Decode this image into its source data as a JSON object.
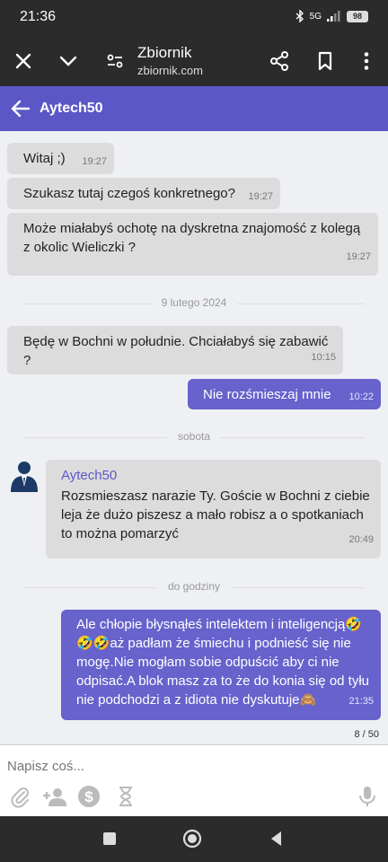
{
  "status_bar": {
    "time": "21:36",
    "network": "5G",
    "battery": "98"
  },
  "browser": {
    "site_title": "Zbiornik",
    "url": "zbiornik.com"
  },
  "chat": {
    "contact_name": "Aytech50"
  },
  "messages": [
    {
      "text": "Witaj ;)",
      "time": "19:27"
    },
    {
      "text": "Szukasz tutaj czegoś konkretnego?",
      "time": "19:27"
    },
    {
      "text": "Może miałabyś ochotę na dyskretna znajomość z kolegą z okolic Wieliczki ?",
      "time": "19:27"
    },
    {
      "separator": "9 lutego 2024"
    },
    {
      "text": "Będę w Bochni w południe. Chciałabyś się zabawić ?",
      "time": "10:15"
    },
    {
      "text": "Nie rozśmieszaj mnie",
      "time": "10:22"
    },
    {
      "separator": "sobota"
    },
    {
      "sender": "Aytech50",
      "text": "Rozsmieszasz narazie Ty. Goście w Bochni z ciebie leja że dużo piszesz a mało robisz a o spotkaniach to można pomarzyć",
      "time": "20:49"
    },
    {
      "separator": "do godziny"
    },
    {
      "text": "Ale chłopie błysnąłeś intelektem i inteligencją🤣🤣🤣aż padłam że śmiechu i podnieść się nie mogę.Nie mogłam sobie odpuścić aby ci nie odpisać.A blok masz za to że do konia się od tyłu nie podchodzi a z idiota nie dyskutuje🙈",
      "time": "21:35"
    }
  ],
  "char_counter": "8 / 50",
  "composer": {
    "placeholder": "Napisz coś..."
  },
  "colors": {
    "accent": "#5b57c7",
    "outgoing_bubble": "#6762cc",
    "incoming_bubble": "#dcdcdc"
  }
}
